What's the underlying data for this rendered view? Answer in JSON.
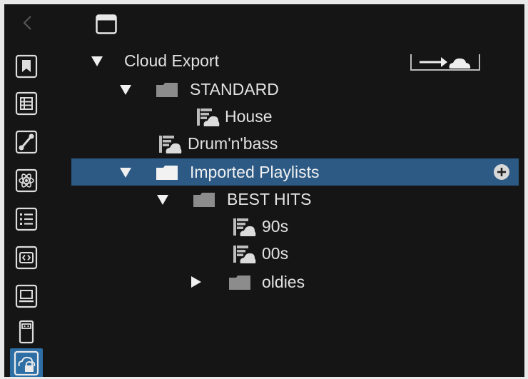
{
  "tree": {
    "root_label": "Cloud Export",
    "standard_label": "STANDARD",
    "house_label": "House",
    "drumnbass_label": "Drum'n'bass",
    "imported_label": "Imported Playlists",
    "besthits_label": "BEST HITS",
    "p90s_label": "90s",
    "p00s_label": "00s",
    "oldies_label": "oldies"
  },
  "colors": {
    "background": "#151515",
    "selected_row": "#2c5a85",
    "active_sidebar": "#2d6ea5",
    "text": "#e2e2e2"
  },
  "icons": {
    "top_left": "chevron-left-icon",
    "top_window": "window-icon",
    "sidebar": [
      "bookmark-icon",
      "grid-icon",
      "link-icon",
      "atom-icon",
      "list-icon",
      "code-icon",
      "laptop-icon",
      "usb-icon",
      "cloud-lock-icon"
    ]
  }
}
